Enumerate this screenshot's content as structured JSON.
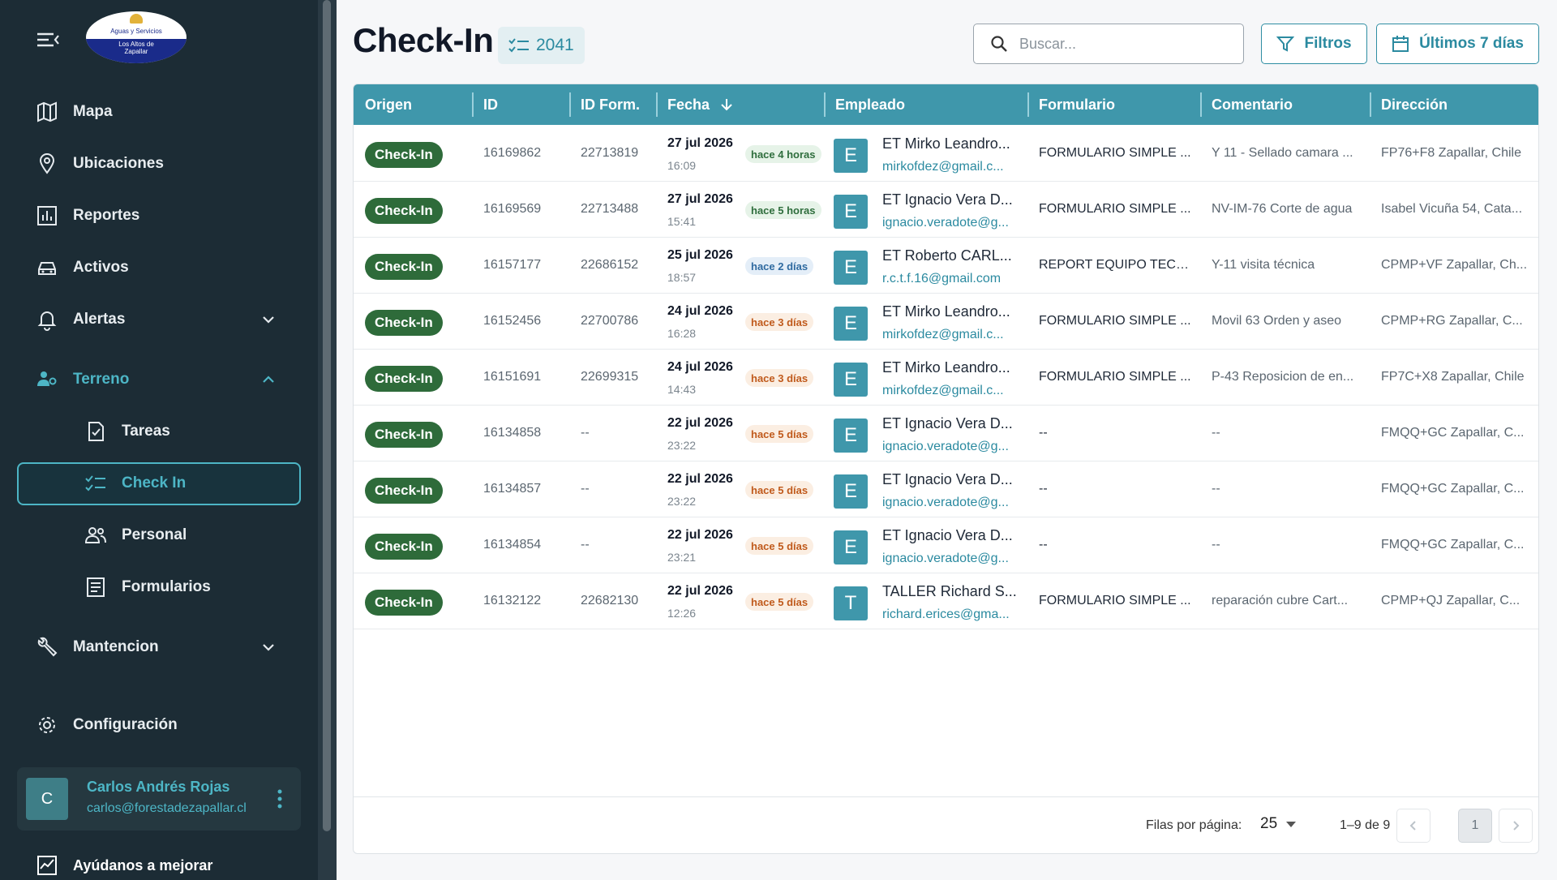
{
  "logo": {
    "line1": "Aguas y Servicios",
    "line2": "Los Altos de",
    "line3": "Zapallar"
  },
  "nav": {
    "mapa": "Mapa",
    "ubicaciones": "Ubicaciones",
    "reportes": "Reportes",
    "activos": "Activos",
    "alertas": "Alertas",
    "terreno": "Terreno",
    "tareas": "Tareas",
    "checkin": "Check In",
    "personal": "Personal",
    "formularios": "Formularios",
    "mantencion": "Mantencion",
    "configuracion": "Configuración",
    "help": "Ayúdanos a mejorar"
  },
  "user": {
    "initial": "C",
    "name": "Carlos Andrés Rojas",
    "email": "carlos@forestadezapallar.cl"
  },
  "page": {
    "title": "Check-In",
    "count": "2041"
  },
  "search": {
    "placeholder": "Buscar..."
  },
  "toolbar": {
    "filters": "Filtros",
    "range": "Últimos 7 días"
  },
  "columns": {
    "origen": "Origen",
    "id": "ID",
    "id_form": "ID Form.",
    "fecha": "Fecha",
    "empleado": "Empleado",
    "formulario": "Formulario",
    "comentario": "Comentario",
    "direccion": "Dirección"
  },
  "rows": [
    {
      "origen": "Check-In",
      "id": "16169862",
      "id_form": "22713819",
      "date": "27 jul 2026",
      "time": "16:09",
      "rel": "hace 4 horas",
      "rel_kind": "green",
      "initial": "E",
      "name": "ET Mirko Leandro...",
      "email": "mirkofdez@gmail.c...",
      "form": "FORMULARIO SIMPLE ...",
      "comment": "Y 11 - Sellado camara ...",
      "address": "FP76+F8 Zapallar, Chile"
    },
    {
      "origen": "Check-In",
      "id": "16169569",
      "id_form": "22713488",
      "date": "27 jul 2026",
      "time": "15:41",
      "rel": "hace 5 horas",
      "rel_kind": "green",
      "initial": "E",
      "name": "ET Ignacio Vera D...",
      "email": "ignacio.veradote@g...",
      "form": "FORMULARIO SIMPLE ...",
      "comment": "NV-IM-76 Corte de agua",
      "address": "Isabel Vicuña 54, Cata..."
    },
    {
      "origen": "Check-In",
      "id": "16157177",
      "id_form": "22686152",
      "date": "25 jul 2026",
      "time": "18:57",
      "rel": "hace 2 días",
      "rel_kind": "blue",
      "initial": "E",
      "name": "ET Roberto CARL...",
      "email": "r.c.t.f.16@gmail.com",
      "form": "REPORT EQUIPO TECN...",
      "comment": "Y-11 visita técnica",
      "address": "CPMP+VF Zapallar, Ch..."
    },
    {
      "origen": "Check-In",
      "id": "16152456",
      "id_form": "22700786",
      "date": "24 jul 2026",
      "time": "16:28",
      "rel": "hace 3 días",
      "rel_kind": "orange",
      "initial": "E",
      "name": "ET Mirko Leandro...",
      "email": "mirkofdez@gmail.c...",
      "form": "FORMULARIO SIMPLE ...",
      "comment": "Movil 63 Orden y aseo",
      "address": "CPMP+RG Zapallar, C..."
    },
    {
      "origen": "Check-In",
      "id": "16151691",
      "id_form": "22699315",
      "date": "24 jul 2026",
      "time": "14:43",
      "rel": "hace 3 días",
      "rel_kind": "orange",
      "initial": "E",
      "name": "ET Mirko Leandro...",
      "email": "mirkofdez@gmail.c...",
      "form": "FORMULARIO SIMPLE ...",
      "comment": "P-43 Reposicion de en...",
      "address": "FP7C+X8 Zapallar, Chile"
    },
    {
      "origen": "Check-In",
      "id": "16134858",
      "id_form": "--",
      "date": "22 jul 2026",
      "time": "23:22",
      "rel": "hace 5 días",
      "rel_kind": "orange",
      "initial": "E",
      "name": "ET Ignacio Vera D...",
      "email": "ignacio.veradote@g...",
      "form": "--",
      "comment": "--",
      "address": "FMQQ+GC Zapallar, C..."
    },
    {
      "origen": "Check-In",
      "id": "16134857",
      "id_form": "--",
      "date": "22 jul 2026",
      "time": "23:22",
      "rel": "hace 5 días",
      "rel_kind": "orange",
      "initial": "E",
      "name": "ET Ignacio Vera D...",
      "email": "ignacio.veradote@g...",
      "form": "--",
      "comment": "--",
      "address": "FMQQ+GC Zapallar, C..."
    },
    {
      "origen": "Check-In",
      "id": "16134854",
      "id_form": "--",
      "date": "22 jul 2026",
      "time": "23:21",
      "rel": "hace 5 días",
      "rel_kind": "orange",
      "initial": "E",
      "name": "ET Ignacio Vera D...",
      "email": "ignacio.veradote@g...",
      "form": "--",
      "comment": "--",
      "address": "FMQQ+GC Zapallar, C..."
    },
    {
      "origen": "Check-In",
      "id": "16132122",
      "id_form": "22682130",
      "date": "22 jul 2026",
      "time": "12:26",
      "rel": "hace 5 días",
      "rel_kind": "orange",
      "initial": "T",
      "name": "TALLER Richard S...",
      "email": "richard.erices@gma...",
      "form": "FORMULARIO SIMPLE ...",
      "comment": "reparación cubre Cart...",
      "address": "CPMP+QJ Zapallar, C..."
    }
  ],
  "footer": {
    "rows_label": "Filas por página:",
    "rows_value": "25",
    "range": "1–9 de 9",
    "page": "1"
  }
}
